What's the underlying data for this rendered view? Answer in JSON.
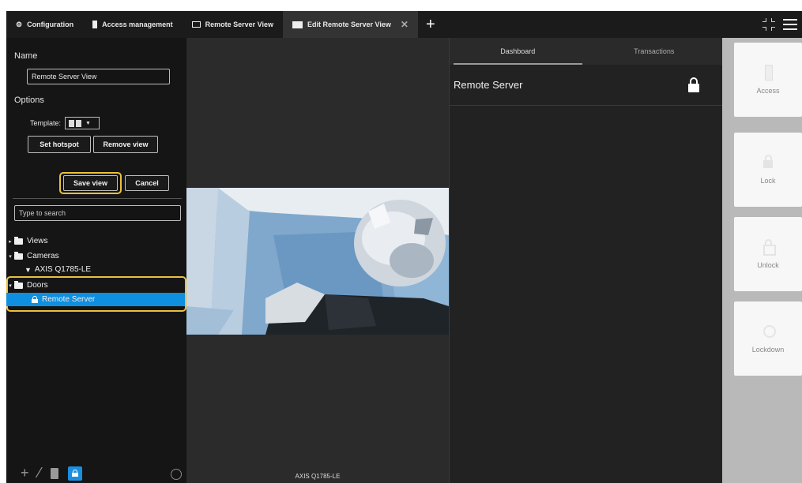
{
  "tabs": [
    {
      "label": "Configuration",
      "icon": "gear-icon"
    },
    {
      "label": "Access management",
      "icon": "door-icon"
    },
    {
      "label": "Remote Server View",
      "icon": "monitor-icon"
    },
    {
      "label": "Edit Remote Server View",
      "icon": "edit-view-icon",
      "close": "✕"
    }
  ],
  "tab_add": "+",
  "left": {
    "name_label": "Name",
    "name_value": "Remote Server View",
    "options_label": "Options",
    "template_label": "Template:",
    "set_hotspot": "Set hotspot",
    "remove_view": "Remove view",
    "save_view": "Save view",
    "cancel": "Cancel",
    "search_placeholder": "Type to search",
    "tree": {
      "views": "Views",
      "cameras": "Cameras",
      "camera_item": "AXIS Q1785-LE",
      "doors": "Doors",
      "door_item": "Remote Server"
    }
  },
  "camera": {
    "caption": "AXIS Q1785-LE"
  },
  "right": {
    "tabs": [
      "Dashboard",
      "Transactions"
    ],
    "door_title": "Remote Server"
  },
  "actions": [
    "Access",
    "Lock",
    "Unlock",
    "Lockdown"
  ],
  "colors": {
    "accent": "#0f8fe0",
    "highlight": "#e9c13c",
    "bg_dark": "#151515"
  }
}
